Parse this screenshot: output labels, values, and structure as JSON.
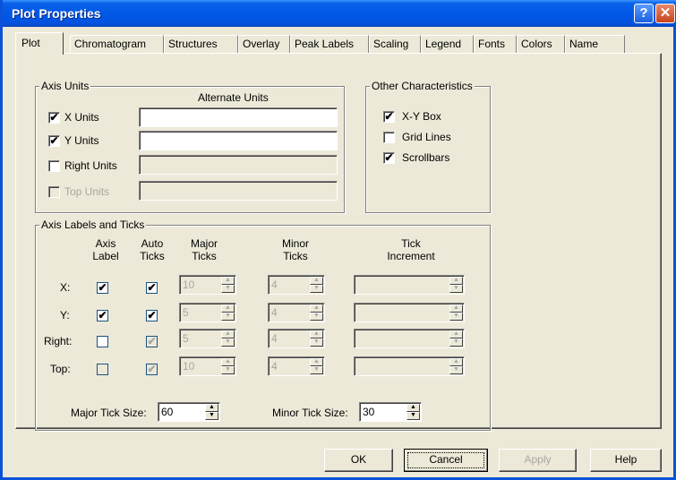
{
  "window": {
    "title": "Plot Properties",
    "help_glyph": "?",
    "close_glyph": "✕"
  },
  "tabs": [
    "Plot",
    "Chromatogram",
    "Structures",
    "Overlay",
    "Peak Labels",
    "Scaling",
    "Legend",
    "Fonts",
    "Colors",
    "Name"
  ],
  "axis_units": {
    "group_label": "Axis Units",
    "alternate_header": "Alternate Units",
    "rows": [
      {
        "label": "X Units",
        "checked": true,
        "enabled": true,
        "value": ""
      },
      {
        "label": "Y Units",
        "checked": true,
        "enabled": true,
        "value": ""
      },
      {
        "label": "Right Units",
        "checked": false,
        "enabled": true,
        "value": ""
      },
      {
        "label": "Top Units",
        "checked": false,
        "enabled": false,
        "value": ""
      }
    ]
  },
  "other": {
    "group_label": "Other Characteristics",
    "items": [
      {
        "label": "X-Y Box",
        "checked": true
      },
      {
        "label": "Grid Lines",
        "checked": false
      },
      {
        "label": "Scrollbars",
        "checked": true
      }
    ]
  },
  "ticks": {
    "group_label": "Axis Labels and Ticks",
    "headers": {
      "axis_label": [
        "Axis",
        "Label"
      ],
      "auto_ticks": [
        "Auto",
        "Ticks"
      ],
      "major_ticks": [
        "Major",
        "Ticks"
      ],
      "minor_ticks": [
        "Minor",
        "Ticks"
      ],
      "tick_increment": [
        "Tick",
        "Increment"
      ]
    },
    "rows": [
      {
        "label": "X:",
        "axis_label": true,
        "axis_label_enabled": true,
        "auto": true,
        "auto_enabled": true,
        "major": "10",
        "minor": "4",
        "increment": ""
      },
      {
        "label": "Y:",
        "axis_label": true,
        "axis_label_enabled": true,
        "auto": true,
        "auto_enabled": true,
        "major": "5",
        "minor": "4",
        "increment": ""
      },
      {
        "label": "Right:",
        "axis_label": false,
        "axis_label_enabled": true,
        "auto": true,
        "auto_enabled": false,
        "major": "5",
        "minor": "4",
        "increment": ""
      },
      {
        "label": "Top:",
        "axis_label": false,
        "axis_label_enabled": false,
        "auto": true,
        "auto_enabled": false,
        "major": "10",
        "minor": "4",
        "increment": ""
      }
    ],
    "major_tick_size_label": "Major Tick Size:",
    "major_tick_size": "60",
    "minor_tick_size_label": "Minor Tick Size:",
    "minor_tick_size": "30"
  },
  "buttons": {
    "ok": "OK",
    "cancel": "Cancel",
    "apply": "Apply",
    "help": "Help"
  },
  "glyphs": {
    "check": "✔",
    "spin_up": "▲",
    "spin_down": "▼"
  }
}
